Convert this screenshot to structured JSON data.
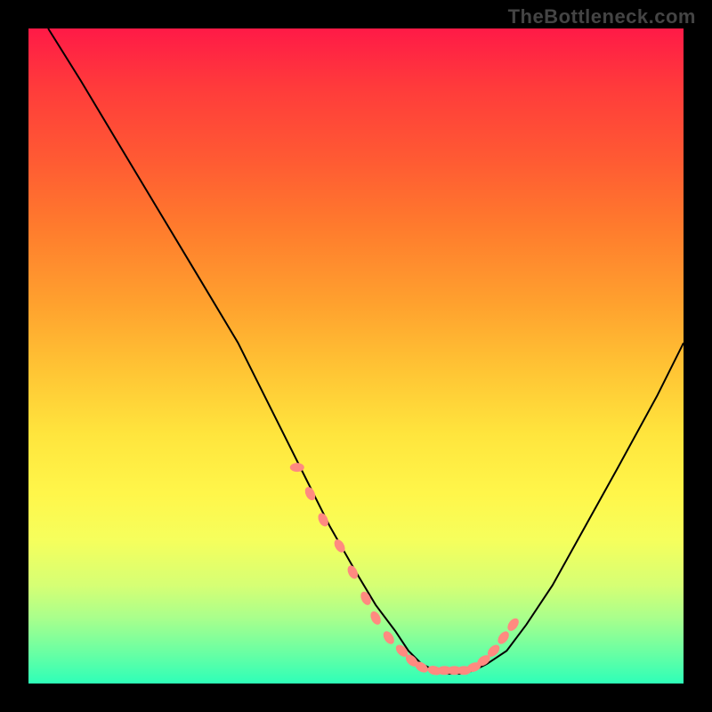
{
  "watermark": "TheBottleneck.com",
  "colors": {
    "background": "#000000",
    "gradient_top": "#ff1a47",
    "gradient_bottom": "#2effb8",
    "curve": "#000000",
    "marker": "#ff8a80"
  },
  "chart_data": {
    "type": "line",
    "title": "",
    "xlabel": "",
    "ylabel": "",
    "xlim": [
      0,
      100
    ],
    "ylim": [
      0,
      100
    ],
    "series": [
      {
        "name": "curve",
        "x": [
          3,
          8,
          14,
          20,
          26,
          32,
          37,
          42,
          46,
          50,
          53,
          56,
          58,
          60,
          62,
          64,
          66,
          68,
          70,
          73,
          76,
          80,
          85,
          90,
          96,
          100
        ],
        "y": [
          100,
          92,
          82,
          72,
          62,
          52,
          42,
          32,
          24,
          17,
          12,
          8,
          5,
          3,
          2,
          1.5,
          1.5,
          2,
          3,
          5,
          9,
          15,
          24,
          33,
          44,
          52
        ]
      }
    ],
    "markers": {
      "name": "highlighted-points",
      "x": [
        41,
        43,
        45,
        47.5,
        49.5,
        51.5,
        53,
        55,
        57,
        58.5,
        60,
        62,
        63.5,
        65,
        66.5,
        68,
        69.5,
        71,
        72.5,
        74
      ],
      "y": [
        33,
        29,
        25,
        21,
        17,
        13,
        10,
        7,
        5,
        3.5,
        2.5,
        2,
        2,
        2,
        2,
        2.5,
        3.5,
        5,
        7,
        9
      ]
    }
  }
}
